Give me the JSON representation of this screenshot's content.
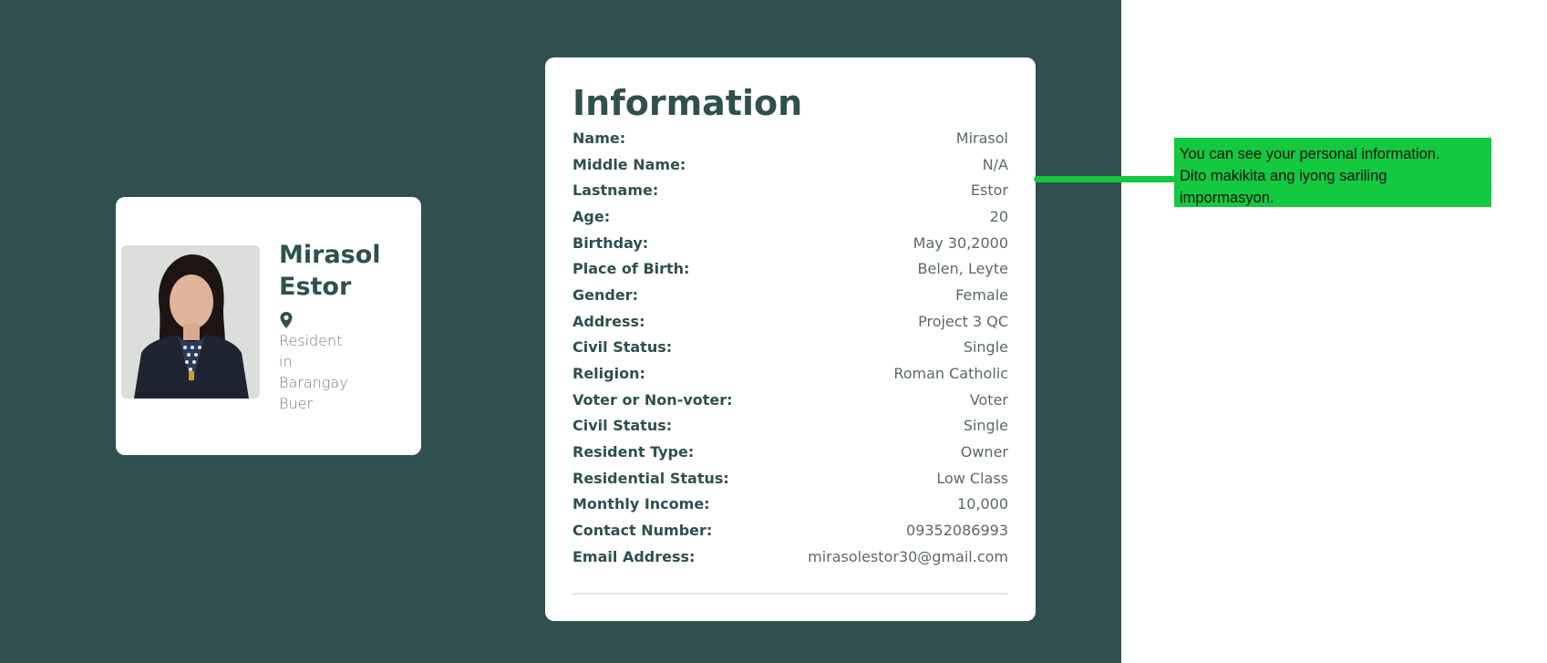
{
  "profile": {
    "first_name": "Mirasol",
    "last_name": "Estor",
    "location_lines": [
      "Resident",
      "in",
      "Barangay",
      "Buer"
    ]
  },
  "info": {
    "title": "Information",
    "rows": [
      {
        "label": "Name:",
        "value": "Mirasol"
      },
      {
        "label": "Middle Name:",
        "value": "N/A"
      },
      {
        "label": "Lastname:",
        "value": "Estor"
      },
      {
        "label": "Age:",
        "value": "20"
      },
      {
        "label": "Birthday:",
        "value": "May 30,2000"
      },
      {
        "label": "Place of Birth:",
        "value": "Belen, Leyte"
      },
      {
        "label": "Gender:",
        "value": "Female"
      },
      {
        "label": "Address:",
        "value": "Project 3 QC"
      },
      {
        "label": "Civil Status:",
        "value": "Single"
      },
      {
        "label": "Religion:",
        "value": "Roman Catholic"
      },
      {
        "label": "Voter or Non-voter:",
        "value": "Voter"
      },
      {
        "label": "Civil Status:",
        "value": "Single"
      },
      {
        "label": "Resident Type:",
        "value": "Owner"
      },
      {
        "label": "Residential Status:",
        "value": "Low Class"
      },
      {
        "label": "Monthly Income:",
        "value": "10,000"
      },
      {
        "label": "Contact Number:",
        "value": "09352086993"
      },
      {
        "label": "Email Address:",
        "value": "mirasolestor30@gmail.com"
      }
    ]
  },
  "callout": {
    "line1": "You can see your personal information.",
    "line2": "Dito makikita ang iyong sariling",
    "line3": "impormasyon."
  },
  "colors": {
    "background": "#2f504f",
    "accent": "#14c840",
    "card": "#ffffff"
  },
  "icons": {
    "location": "map-pin-icon"
  }
}
